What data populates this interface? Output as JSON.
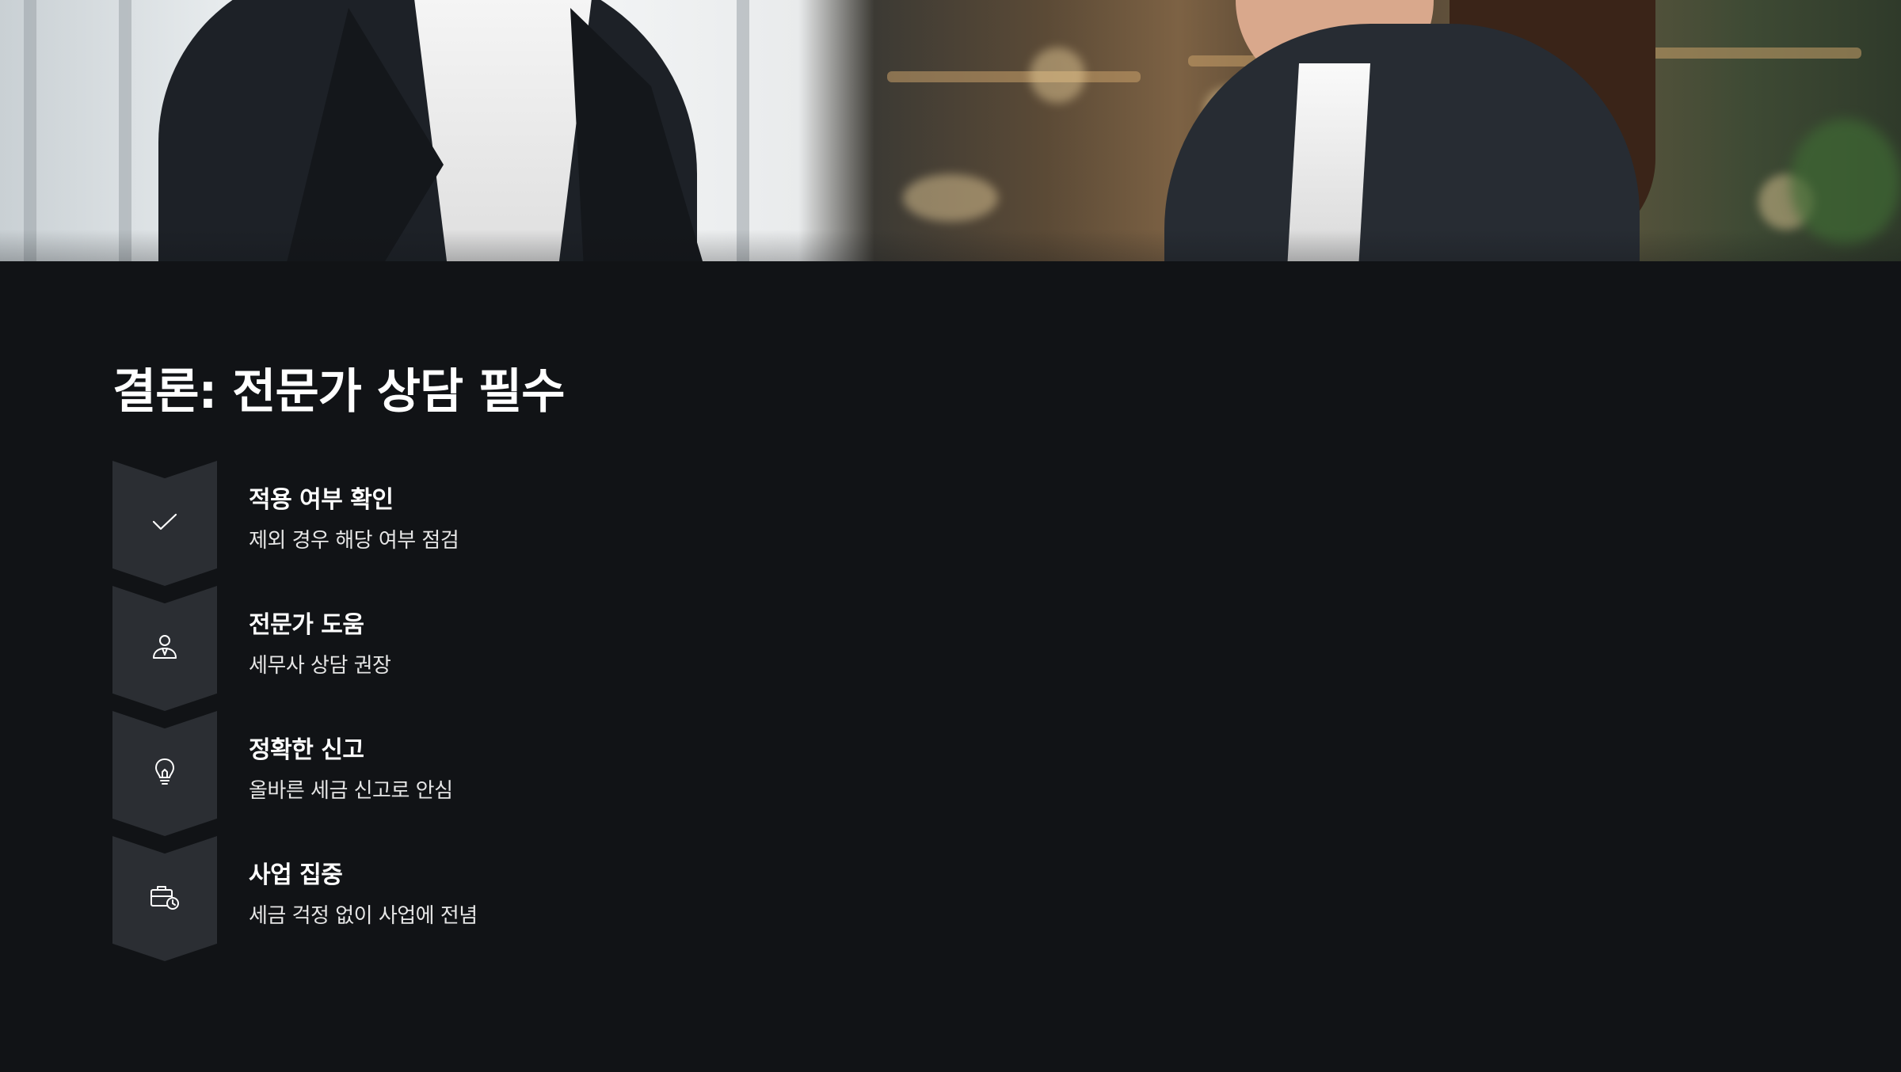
{
  "slide": {
    "title": "결론: 전문가 상담 필수"
  },
  "steps": [
    {
      "icon": "check-icon",
      "title": "적용 여부 확인",
      "description": "제외 경우 해당 여부 점검"
    },
    {
      "icon": "person-advisor-icon",
      "title": "전문가 도움",
      "description": "세무사 상담 권장"
    },
    {
      "icon": "lightbulb-icon",
      "title": "정확한 신고",
      "description": "올바른 세금 신고로 안심"
    },
    {
      "icon": "briefcase-clock-icon",
      "title": "사업 집중",
      "description": "세금 걱정 없이 사업에 전념"
    }
  ],
  "colors": {
    "background": "#111316",
    "chevron": "#2b2e33",
    "text": "#ffffff",
    "subtext": "#e6e6e6"
  }
}
